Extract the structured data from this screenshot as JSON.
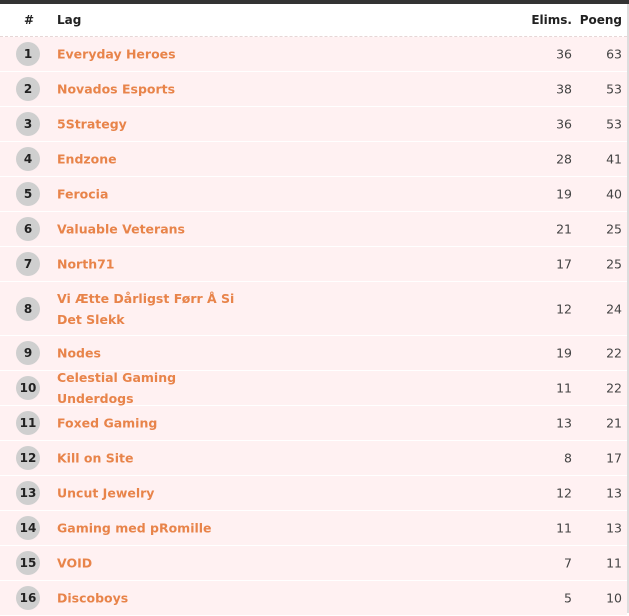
{
  "columns": {
    "rank": "#",
    "team": "Lag",
    "elims": "Elims.",
    "points": "Poeng"
  },
  "rows": [
    {
      "rank": "1",
      "team": "Everyday Heroes",
      "elims": "36",
      "points": "63"
    },
    {
      "rank": "2",
      "team": "Novados Esports",
      "elims": "38",
      "points": "53"
    },
    {
      "rank": "3",
      "team": "5Strategy",
      "elims": "36",
      "points": "53"
    },
    {
      "rank": "4",
      "team": "Endzone",
      "elims": "28",
      "points": "41"
    },
    {
      "rank": "5",
      "team": "Ferocia",
      "elims": "19",
      "points": "40"
    },
    {
      "rank": "6",
      "team": "Valuable Veterans",
      "elims": "21",
      "points": "25"
    },
    {
      "rank": "7",
      "team": "North71",
      "elims": "17",
      "points": "25"
    },
    {
      "rank": "8",
      "team": "Vi Ætte Dårligst Førr Å Si Det Slekk",
      "elims": "12",
      "points": "24"
    },
    {
      "rank": "9",
      "team": "Nodes",
      "elims": "19",
      "points": "22"
    },
    {
      "rank": "10",
      "team": "Celestial Gaming Underdogs",
      "elims": "11",
      "points": "22"
    },
    {
      "rank": "11",
      "team": "Foxed Gaming",
      "elims": "13",
      "points": "21"
    },
    {
      "rank": "12",
      "team": "Kill on Site",
      "elims": "8",
      "points": "17"
    },
    {
      "rank": "13",
      "team": "Uncut Jewelry",
      "elims": "12",
      "points": "13"
    },
    {
      "rank": "14",
      "team": "Gaming med pRomille",
      "elims": "11",
      "points": "13"
    },
    {
      "rank": "15",
      "team": "VOID",
      "elims": "7",
      "points": "11"
    },
    {
      "rank": "16",
      "team": "Discoboys",
      "elims": "5",
      "points": "10"
    }
  ],
  "colors": {
    "team_link": "#e8844a",
    "row_background": "#fff1f2",
    "rank_badge": "#cfcfcf",
    "top_bar": "#333333"
  }
}
